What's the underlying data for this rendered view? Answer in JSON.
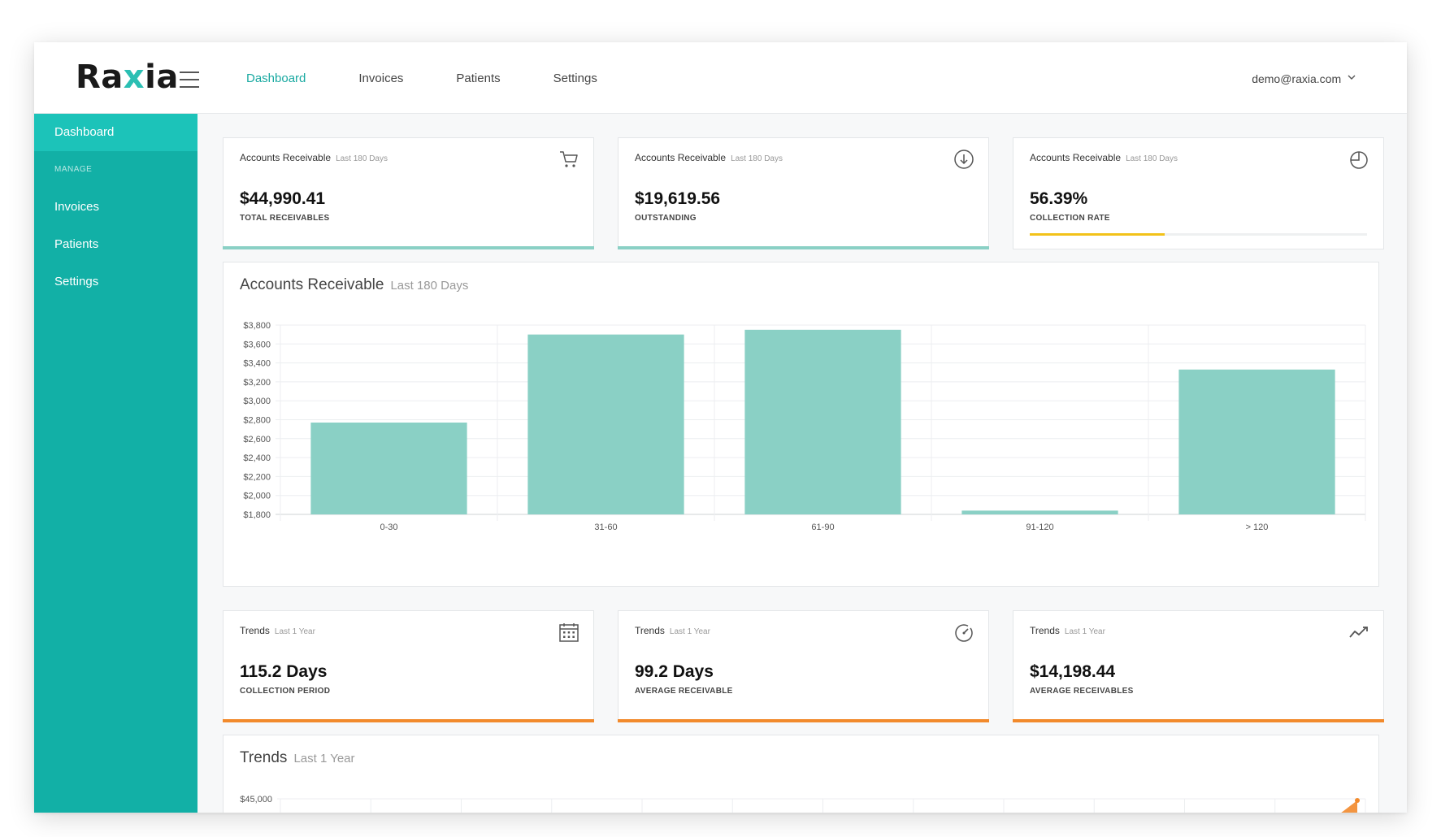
{
  "app": {
    "logo_pre": "Ra",
    "logo_x": "x",
    "logo_post": "ia"
  },
  "topnav": {
    "items": [
      "Dashboard",
      "Invoices",
      "Patients",
      "Settings"
    ],
    "active": "Dashboard"
  },
  "user": {
    "email": "demo@raxia.com"
  },
  "sidebar": {
    "dashboard": "Dashboard",
    "section_label": "MANAGE",
    "items": [
      "Invoices",
      "Patients",
      "Settings"
    ]
  },
  "kpis_top": [
    {
      "title": "Accounts Receivable",
      "subtitle": "Last 180 Days",
      "value": "$44,990.41",
      "label": "TOTAL RECEIVABLES",
      "icon": "cart-icon"
    },
    {
      "title": "Accounts Receivable",
      "subtitle": "Last 180 Days",
      "value": "$19,619.56",
      "label": "OUTSTANDING",
      "icon": "download-circle-icon"
    },
    {
      "title": "Accounts Receivable",
      "subtitle": "Last 180 Days",
      "value": "56.39%",
      "label": "COLLECTION RATE",
      "icon": "pie-icon",
      "progress": 0.4
    }
  ],
  "kpis_bottom": [
    {
      "title": "Trends",
      "subtitle": "Last 1 Year",
      "value": "115.2 Days",
      "label": "COLLECTION PERIOD",
      "icon": "calendar-icon"
    },
    {
      "title": "Trends",
      "subtitle": "Last 1 Year",
      "value": "99.2 Days",
      "label": "AVERAGE RECEIVABLE",
      "icon": "gauge-icon"
    },
    {
      "title": "Trends",
      "subtitle": "Last 1 Year",
      "value": "$14,198.44",
      "label": "AVERAGE RECEIVABLES",
      "icon": "trend-line-icon"
    }
  ],
  "colors": {
    "accent": "#12b0a6",
    "bar": "#8ad0c5",
    "orange": "#f28a2c",
    "yellow": "#f2c219"
  },
  "chart_data": [
    {
      "type": "bar",
      "title": "Accounts Receivable",
      "subtitle": "Last 180 Days",
      "categories": [
        "0-30",
        "31-60",
        "61-90",
        "91-120",
        "> 120"
      ],
      "values": [
        2770,
        3700,
        3750,
        1840,
        3330
      ],
      "ylim": [
        1800,
        3800
      ],
      "yticks": [
        "$3,800",
        "$3,600",
        "$3,400",
        "$3,200",
        "$3,000",
        "$2,800",
        "$2,600",
        "$2,400",
        "$2,200",
        "$2,000",
        "$1,800"
      ],
      "grid": true
    },
    {
      "type": "area",
      "title": "Trends",
      "subtitle": "Last 1 Year",
      "yticks": [
        "$45,000"
      ],
      "grid": true
    }
  ]
}
